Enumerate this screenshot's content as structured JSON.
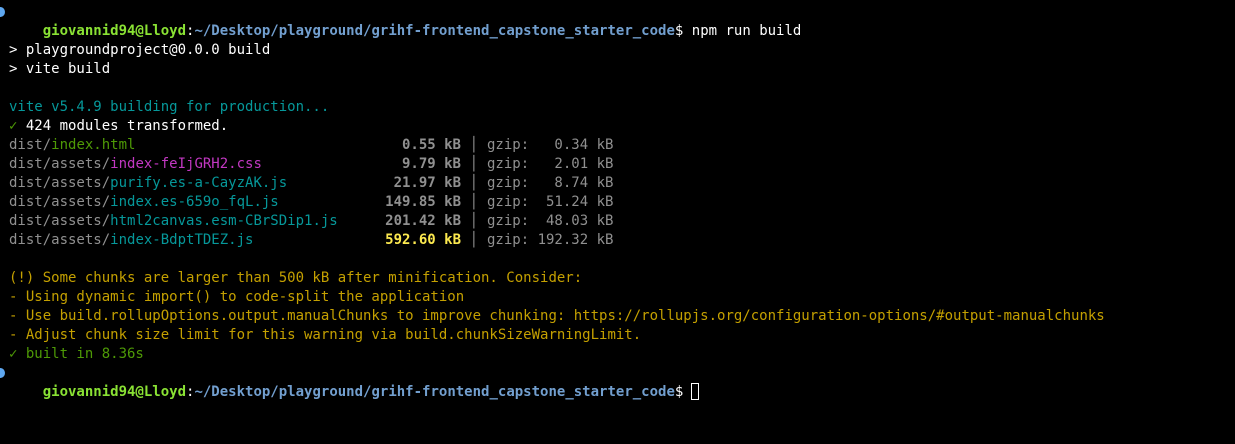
{
  "prompt": {
    "user_host": "giovannid94@Lloyd",
    "colon": ":",
    "path": "~/Desktop/playground/grihf-frontend_capstone_starter_code",
    "symbol": "$"
  },
  "command": "npm run build",
  "npm_output": [
    "> playgroundproject@0.0.0 build",
    "> vite build"
  ],
  "vite": {
    "building": "vite v5.4.9 building for production...",
    "check": "✓",
    "modules": " 424 modules transformed."
  },
  "files": [
    {
      "dir": "dist/",
      "name": "index.html",
      "size": "0.55 kB",
      "sep": "│",
      "gzip": "gzip:   0.34 kB",
      "name_color": "#4e9a06"
    },
    {
      "dir": "dist/assets/",
      "name": "index-feIjGRH2.css",
      "size": "9.79 kB",
      "sep": "│",
      "gzip": "gzip:   2.01 kB",
      "name_color": "#c238c2"
    },
    {
      "dir": "dist/assets/",
      "name": "purify.es-a-CayzAK.js",
      "size": "21.97 kB",
      "sep": "│",
      "gzip": "gzip:   8.74 kB",
      "name_color": "#06989a"
    },
    {
      "dir": "dist/assets/",
      "name": "index.es-659o_fqL.js",
      "size": "149.85 kB",
      "sep": "│",
      "gzip": "gzip:  51.24 kB",
      "name_color": "#06989a"
    },
    {
      "dir": "dist/assets/",
      "name": "html2canvas.esm-CBrSDip1.js",
      "size": "201.42 kB",
      "sep": "│",
      "gzip": "gzip:  48.03 kB",
      "name_color": "#06989a"
    },
    {
      "dir": "dist/assets/",
      "name": "index-BdptTDEZ.js",
      "size": "592.60 kB",
      "sep": "│",
      "gzip": "gzip: 192.32 kB",
      "name_color": "#06989a",
      "warn": true
    }
  ],
  "warning": [
    "(!) Some chunks are larger than 500 kB after minification. Consider:",
    "- Using dynamic import() to code-split the application",
    "- Use build.rollupOptions.output.manualChunks to improve chunking: https://rollupjs.org/configuration-options/#output-manualchunks",
    "- Adjust chunk size limit for this warning via build.chunkSizeWarningLimit."
  ],
  "built": "✓ built in 8.36s",
  "colors": {
    "background": "#000000",
    "user": "#8ae234",
    "path": "#729fcf",
    "vite": "#06989a",
    "success": "#4e9a06",
    "warning_text": "#c4a000",
    "size_warn": "#fce94f"
  }
}
